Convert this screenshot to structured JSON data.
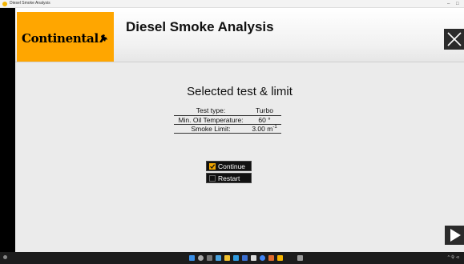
{
  "window": {
    "title": "Diesel Smoke Analysis",
    "minimize": "–",
    "maximize": "□"
  },
  "header": {
    "brand": "Continental",
    "app_title": "Diesel Smoke Analysis"
  },
  "section": {
    "title": "Selected test & limit",
    "rows": [
      {
        "label": "Test type:",
        "value": "Turbo"
      },
      {
        "label": "Min. Oil Temperature:",
        "value": "60 °"
      },
      {
        "label": "Smoke Limit:",
        "value": "3.00 m",
        "sup": "-1"
      }
    ]
  },
  "buttons": {
    "continue": "Continue",
    "restart": "Restart"
  },
  "taskbar": {
    "tray_text": "^ 令 ⊲"
  },
  "colors": {
    "accent": "#ffa600",
    "button": "#111111",
    "check": "#f0a500"
  }
}
